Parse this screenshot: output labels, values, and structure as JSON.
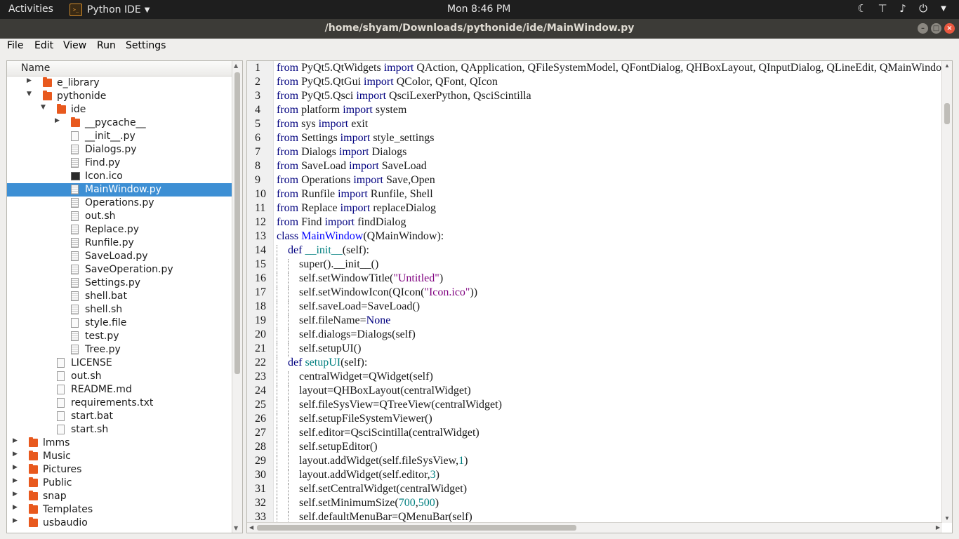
{
  "topbar": {
    "activities": "Activities",
    "app_name": "Python IDE",
    "clock": "Mon  8:46 PM",
    "icons": [
      "night-mode-icon",
      "network-icon",
      "volume-icon",
      "power-icon"
    ]
  },
  "window": {
    "title": "/home/shyam/Downloads/pythonide/ide/MainWindow.py"
  },
  "menu": [
    "File",
    "Edit",
    "View",
    "Run",
    "Settings"
  ],
  "tree": {
    "header": "Name",
    "items": [
      {
        "label": "e_library",
        "type": "folder",
        "depth": 3,
        "arrow": "collapsed"
      },
      {
        "label": "pythonide",
        "type": "folder",
        "depth": 3,
        "arrow": "expanded"
      },
      {
        "label": "ide",
        "type": "folder",
        "depth": 4,
        "arrow": "expanded"
      },
      {
        "label": "__pycache__",
        "type": "folder",
        "depth": 5,
        "arrow": "collapsed"
      },
      {
        "label": "__init__.py",
        "type": "file",
        "depth": 5
      },
      {
        "label": "Dialogs.py",
        "type": "pyfile",
        "depth": 5
      },
      {
        "label": "Find.py",
        "type": "pyfile",
        "depth": 5
      },
      {
        "label": "Icon.ico",
        "type": "image",
        "depth": 5
      },
      {
        "label": "MainWindow.py",
        "type": "pyfile",
        "depth": 5,
        "selected": true
      },
      {
        "label": "Operations.py",
        "type": "pyfile",
        "depth": 5
      },
      {
        "label": "out.sh",
        "type": "pyfile",
        "depth": 5
      },
      {
        "label": "Replace.py",
        "type": "pyfile",
        "depth": 5
      },
      {
        "label": "Runfile.py",
        "type": "pyfile",
        "depth": 5
      },
      {
        "label": "SaveLoad.py",
        "type": "pyfile",
        "depth": 5
      },
      {
        "label": "SaveOperation.py",
        "type": "pyfile",
        "depth": 5
      },
      {
        "label": "Settings.py",
        "type": "pyfile",
        "depth": 5
      },
      {
        "label": "shell.bat",
        "type": "pyfile",
        "depth": 5
      },
      {
        "label": "shell.sh",
        "type": "pyfile",
        "depth": 5
      },
      {
        "label": "style.file",
        "type": "file",
        "depth": 5
      },
      {
        "label": "test.py",
        "type": "pyfile",
        "depth": 5
      },
      {
        "label": "Tree.py",
        "type": "pyfile",
        "depth": 5
      },
      {
        "label": "LICENSE",
        "type": "file",
        "depth": 4
      },
      {
        "label": "out.sh",
        "type": "file",
        "depth": 4
      },
      {
        "label": "README.md",
        "type": "file",
        "depth": 4
      },
      {
        "label": "requirements.txt",
        "type": "file",
        "depth": 4
      },
      {
        "label": "start.bat",
        "type": "file",
        "depth": 4
      },
      {
        "label": "start.sh",
        "type": "file",
        "depth": 4
      },
      {
        "label": "lmms",
        "type": "folder",
        "depth": 2,
        "arrow": "collapsed"
      },
      {
        "label": "Music",
        "type": "folder",
        "depth": 2,
        "arrow": "collapsed"
      },
      {
        "label": "Pictures",
        "type": "folder",
        "depth": 2,
        "arrow": "collapsed"
      },
      {
        "label": "Public",
        "type": "folder",
        "depth": 2,
        "arrow": "collapsed"
      },
      {
        "label": "snap",
        "type": "folder",
        "depth": 2,
        "arrow": "collapsed"
      },
      {
        "label": "Templates",
        "type": "folder",
        "depth": 2,
        "arrow": "collapsed"
      },
      {
        "label": "usbaudio",
        "type": "folder",
        "depth": 2,
        "arrow": "collapsed"
      }
    ]
  },
  "editor": {
    "colors": {
      "keyword": "#00007f",
      "class_name": "#0000ff",
      "function": "#007f7f",
      "string": "#7f007f",
      "number": "#007f7f"
    },
    "lines": [
      {
        "n": "1",
        "indent": 0,
        "tokens": [
          [
            "kw",
            "from"
          ],
          [
            "t",
            " PyQt5.QtWidgets "
          ],
          [
            "kw",
            "import"
          ],
          [
            "t",
            " QAction, QApplication, QFileSystemModel, QFontDialog, QHBoxLayout, QInputDialog, QLineEdit, QMainWindow"
          ]
        ]
      },
      {
        "n": "2",
        "indent": 0,
        "tokens": [
          [
            "kw",
            "from"
          ],
          [
            "t",
            " PyQt5.QtGui "
          ],
          [
            "kw",
            "import"
          ],
          [
            "t",
            " QColor, QFont, QIcon"
          ]
        ]
      },
      {
        "n": "3",
        "indent": 0,
        "tokens": [
          [
            "kw",
            "from"
          ],
          [
            "t",
            " PyQt5.Qsci "
          ],
          [
            "kw",
            "import"
          ],
          [
            "t",
            " QsciLexerPython, QsciScintilla"
          ]
        ]
      },
      {
        "n": "4",
        "indent": 0,
        "tokens": [
          [
            "kw",
            "from"
          ],
          [
            "t",
            " platform "
          ],
          [
            "kw",
            "import"
          ],
          [
            "t",
            " system"
          ]
        ]
      },
      {
        "n": "5",
        "indent": 0,
        "tokens": [
          [
            "kw",
            "from"
          ],
          [
            "t",
            " sys "
          ],
          [
            "kw",
            "import"
          ],
          [
            "t",
            " exit"
          ]
        ]
      },
      {
        "n": "6",
        "indent": 0,
        "tokens": [
          [
            "kw",
            "from"
          ],
          [
            "t",
            " Settings "
          ],
          [
            "kw",
            "import"
          ],
          [
            "t",
            " style_settings"
          ]
        ]
      },
      {
        "n": "7",
        "indent": 0,
        "tokens": [
          [
            "kw",
            "from"
          ],
          [
            "t",
            " Dialogs "
          ],
          [
            "kw",
            "import"
          ],
          [
            "t",
            " Dialogs"
          ]
        ]
      },
      {
        "n": "8",
        "indent": 0,
        "tokens": [
          [
            "kw",
            "from"
          ],
          [
            "t",
            " SaveLoad "
          ],
          [
            "kw",
            "import"
          ],
          [
            "t",
            " SaveLoad"
          ]
        ]
      },
      {
        "n": "9",
        "indent": 0,
        "tokens": [
          [
            "kw",
            "from"
          ],
          [
            "t",
            " Operations "
          ],
          [
            "kw",
            "import"
          ],
          [
            "t",
            " Save,Open"
          ]
        ]
      },
      {
        "n": "10",
        "indent": 0,
        "tokens": [
          [
            "kw",
            "from"
          ],
          [
            "t",
            " Runfile "
          ],
          [
            "kw",
            "import"
          ],
          [
            "t",
            " Runfile, Shell"
          ]
        ]
      },
      {
        "n": "11",
        "indent": 0,
        "tokens": [
          [
            "kw",
            "from"
          ],
          [
            "t",
            " Replace "
          ],
          [
            "kw",
            "import"
          ],
          [
            "t",
            " replaceDialog"
          ]
        ]
      },
      {
        "n": "12",
        "indent": 0,
        "tokens": [
          [
            "kw",
            "from"
          ],
          [
            "t",
            " Find "
          ],
          [
            "kw",
            "import"
          ],
          [
            "t",
            " findDialog"
          ]
        ]
      },
      {
        "n": "13",
        "indent": 0,
        "tokens": [
          [
            "kw",
            "class"
          ],
          [
            "t",
            " "
          ],
          [
            "cls",
            "MainWindow"
          ],
          [
            "t",
            "(QMainWindow):"
          ]
        ]
      },
      {
        "n": "14",
        "indent": 1,
        "tokens": [
          [
            "kw",
            "def"
          ],
          [
            "t",
            " "
          ],
          [
            "fn",
            "__init__"
          ],
          [
            "t",
            "(self):"
          ]
        ]
      },
      {
        "n": "15",
        "indent": 2,
        "tokens": [
          [
            "t",
            "super().__init__()"
          ]
        ]
      },
      {
        "n": "16",
        "indent": 2,
        "tokens": [
          [
            "t",
            "self.setWindowTitle("
          ],
          [
            "str",
            "\"Untitled\""
          ],
          [
            "t",
            ")"
          ]
        ]
      },
      {
        "n": "17",
        "indent": 2,
        "tokens": [
          [
            "t",
            "self.setWindowIcon(QIcon("
          ],
          [
            "str",
            "\"Icon.ico\""
          ],
          [
            "t",
            "))"
          ]
        ]
      },
      {
        "n": "18",
        "indent": 2,
        "tokens": [
          [
            "t",
            "self.saveLoad=SaveLoad()"
          ]
        ]
      },
      {
        "n": "19",
        "indent": 2,
        "tokens": [
          [
            "t",
            "self.fileName="
          ],
          [
            "kw",
            "None"
          ]
        ]
      },
      {
        "n": "20",
        "indent": 2,
        "tokens": [
          [
            "t",
            "self.dialogs=Dialogs(self)"
          ]
        ]
      },
      {
        "n": "21",
        "indent": 2,
        "tokens": [
          [
            "t",
            "self.setupUI()"
          ]
        ]
      },
      {
        "n": "22",
        "indent": 1,
        "tokens": [
          [
            "kw",
            "def"
          ],
          [
            "t",
            " "
          ],
          [
            "fn",
            "setupUI"
          ],
          [
            "t",
            "(self):"
          ]
        ]
      },
      {
        "n": "23",
        "indent": 2,
        "tokens": [
          [
            "t",
            "centralWidget=QWidget(self)"
          ]
        ]
      },
      {
        "n": "24",
        "indent": 2,
        "tokens": [
          [
            "t",
            "layout=QHBoxLayout(centralWidget)"
          ]
        ]
      },
      {
        "n": "25",
        "indent": 2,
        "tokens": [
          [
            "t",
            "self.fileSysView=QTreeView(centralWidget)"
          ]
        ]
      },
      {
        "n": "26",
        "indent": 2,
        "tokens": [
          [
            "t",
            "self.setupFileSystemViewer()"
          ]
        ]
      },
      {
        "n": "27",
        "indent": 2,
        "tokens": [
          [
            "t",
            "self.editor=QsciScintilla(centralWidget)"
          ]
        ]
      },
      {
        "n": "28",
        "indent": 2,
        "tokens": [
          [
            "t",
            "self.setupEditor()"
          ]
        ]
      },
      {
        "n": "29",
        "indent": 2,
        "tokens": [
          [
            "t",
            "layout.addWidget(self.fileSysView,"
          ],
          [
            "num",
            "1"
          ],
          [
            "t",
            ")"
          ]
        ]
      },
      {
        "n": "30",
        "indent": 2,
        "tokens": [
          [
            "t",
            "layout.addWidget(self.editor,"
          ],
          [
            "num",
            "3"
          ],
          [
            "t",
            ")"
          ]
        ]
      },
      {
        "n": "31",
        "indent": 2,
        "tokens": [
          [
            "t",
            "self.setCentralWidget(centralWidget)"
          ]
        ]
      },
      {
        "n": "32",
        "indent": 2,
        "tokens": [
          [
            "t",
            "self.setMinimumSize("
          ],
          [
            "num",
            "700"
          ],
          [
            "t",
            ","
          ],
          [
            "num",
            "500"
          ],
          [
            "t",
            ")"
          ]
        ]
      },
      {
        "n": "33",
        "indent": 2,
        "tokens": [
          [
            "t",
            "self.defaultMenuBar=QMenuBar(self)"
          ]
        ]
      }
    ]
  }
}
